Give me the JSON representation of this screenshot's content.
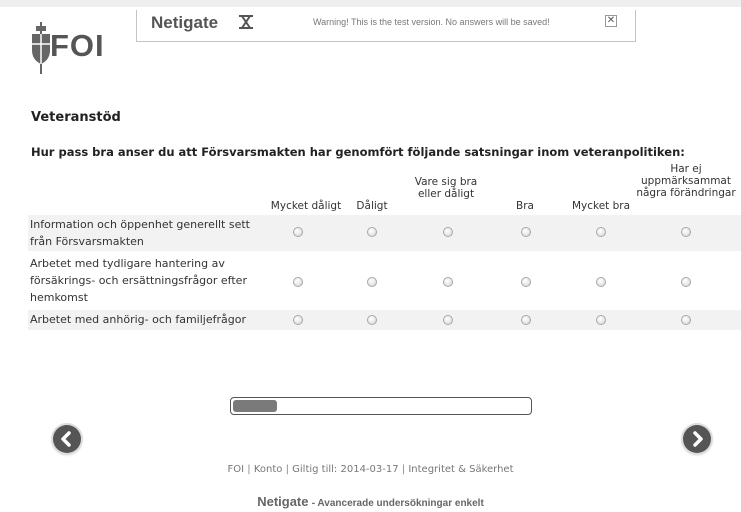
{
  "logo": {
    "text": "FOI"
  },
  "banner": {
    "brand": "Netigate",
    "warning": "Warning! This is the test version. No answers will be saved!",
    "close_symbol": "✕"
  },
  "survey": {
    "section_title": "Veteranstöd",
    "question": "Hur pass bra anser du att Försvarsmakten har genomfört följande satsningar inom veteranpolitiken:",
    "columns": [
      "Mycket dåligt",
      "Dåligt",
      "Vare sig bra eller dåligt",
      "Bra",
      "Mycket bra",
      "Har ej uppmärksammat några förändringar"
    ],
    "rows": [
      {
        "label": "Information och öppenhet generellt sett från Försvarsmakten"
      },
      {
        "label": "Arbetet med tydligare hantering av försäkrings- och ersättningsfrågor efter hemkomst"
      },
      {
        "label": "Arbetet med anhörig- och familjefrågor"
      }
    ]
  },
  "progress": {
    "fraction": 0.15
  },
  "navigation": {
    "back_icon": "chevron-left-icon",
    "next_icon": "chevron-right-icon"
  },
  "footer": {
    "links": [
      "FOI",
      "Konto",
      "Giltig till: 2014-03-17",
      "Integritet & Säkerhet"
    ],
    "brand": "Netigate",
    "tagline": "- Avancerade undersökningar enkelt"
  },
  "colors": {
    "button": "#555555",
    "progress_fill": "#7a7a7a",
    "row_shade": "#f2f2f2"
  }
}
